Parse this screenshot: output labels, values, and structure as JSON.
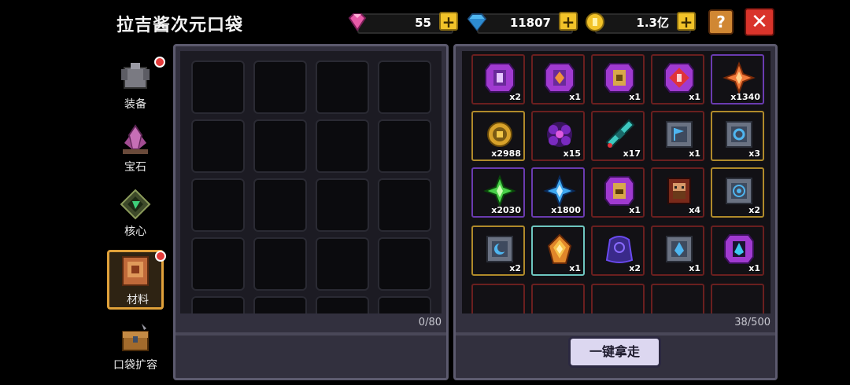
{
  "header": {
    "title": "拉吉酱次元口袋"
  },
  "currencies": [
    {
      "name": "gem",
      "icon": "pink-gem-icon",
      "value": "55"
    },
    {
      "name": "diamond",
      "icon": "blue-diamond-icon",
      "value": "11807"
    },
    {
      "name": "coin",
      "icon": "gold-coin-icon",
      "value": "1.3亿"
    }
  ],
  "buttons": {
    "help": "?",
    "close": "✕",
    "plus": "+",
    "take_all": "一键拿走"
  },
  "sidebar": {
    "items": [
      {
        "label": "装备",
        "icon": "armor-icon",
        "badge": true
      },
      {
        "label": "宝石",
        "icon": "gem-crystal-icon",
        "badge": false
      },
      {
        "label": "核心",
        "icon": "core-icon",
        "badge": false
      },
      {
        "label": "材料",
        "icon": "materials-book-icon",
        "badge": true,
        "active": true
      },
      {
        "label": "口袋扩容",
        "icon": "treasure-chest-icon",
        "badge": false
      }
    ]
  },
  "left_panel": {
    "count": "0/80"
  },
  "right_panel": {
    "count": "38/500",
    "items": [
      {
        "qty": "x2",
        "icon": "purple-scroll-icon",
        "frame": "red"
      },
      {
        "qty": "x1",
        "icon": "purple-orange-rune-icon",
        "frame": "red"
      },
      {
        "qty": "x1",
        "icon": "purple-gold-rune-icon",
        "frame": "red"
      },
      {
        "qty": "x1",
        "icon": "purple-mystery-rune-icon",
        "frame": "red"
      },
      {
        "qty": "x1340",
        "icon": "orange-star-shard-icon",
        "frame": "purple"
      },
      {
        "qty": "x2988",
        "icon": "gold-coin-medal-icon",
        "frame": "gold"
      },
      {
        "qty": "x15",
        "icon": "dark-flower-icon",
        "frame": "red"
      },
      {
        "qty": "x17",
        "icon": "cyan-blade-icon",
        "frame": "red"
      },
      {
        "qty": "x1",
        "icon": "stone-flag-tablet-icon",
        "frame": "red"
      },
      {
        "qty": "x3",
        "icon": "stone-ring-tablet-icon",
        "frame": "gold"
      },
      {
        "qty": "x2030",
        "icon": "green-star-shard-icon",
        "frame": "purple"
      },
      {
        "qty": "x1800",
        "icon": "blue-star-shard-icon",
        "frame": "purple"
      },
      {
        "qty": "x1",
        "icon": "purple-chest-rune-icon",
        "frame": "red"
      },
      {
        "qty": "x4",
        "icon": "warrior-portrait-icon",
        "frame": "red"
      },
      {
        "qty": "x2",
        "icon": "stone-swirl-tablet-icon",
        "frame": "gold"
      },
      {
        "qty": "x2",
        "icon": "stone-moon-tablet-icon",
        "frame": "gold"
      },
      {
        "qty": "x1",
        "icon": "amber-crystal-icon",
        "frame": "cyan"
      },
      {
        "qty": "x2",
        "icon": "blue-cloak-icon",
        "frame": "red"
      },
      {
        "qty": "x1",
        "icon": "stone-flame-tablet-icon",
        "frame": "red"
      },
      {
        "qty": "x1",
        "icon": "purple-blue-flame-rune-icon",
        "frame": "red"
      }
    ]
  }
}
